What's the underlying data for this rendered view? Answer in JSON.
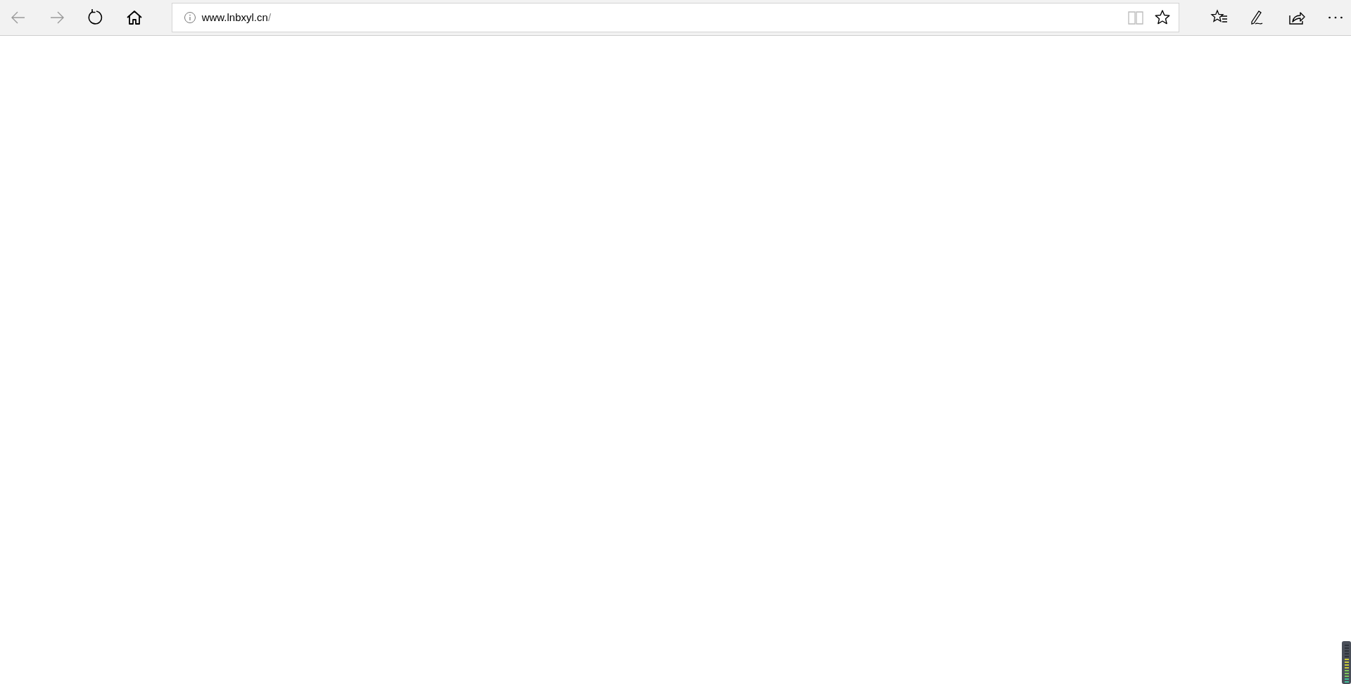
{
  "nav_buttons": [
    {
      "kind": "back",
      "disabled": true
    },
    {
      "kind": "forward",
      "disabled": true
    },
    {
      "kind": "refresh",
      "disabled": false
    },
    {
      "kind": "home",
      "disabled": false
    }
  ],
  "address_bar": {
    "host": "www.lnbxyl.cn",
    "path": "/",
    "reading_view_disabled": true
  },
  "toolbar_buttons": [
    {
      "kind": "favorites"
    },
    {
      "kind": "notes"
    },
    {
      "kind": "share"
    },
    {
      "kind": "more"
    }
  ]
}
